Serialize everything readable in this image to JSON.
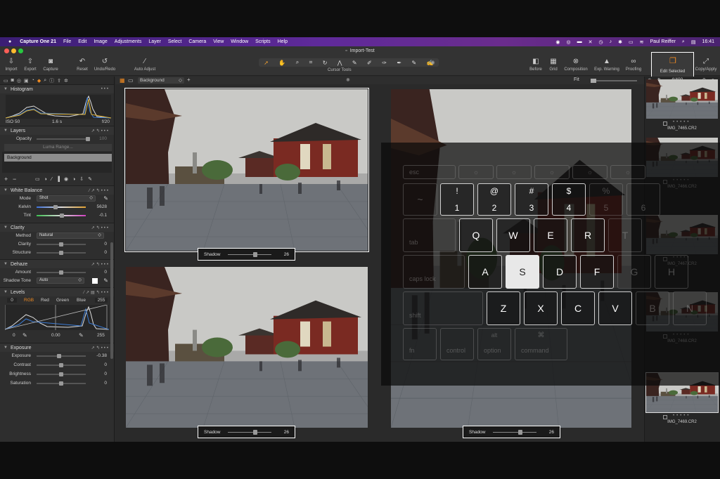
{
  "menubar": {
    "app": "Capture One 21",
    "items": [
      "File",
      "Edit",
      "Image",
      "Adjustments",
      "Layer",
      "Select",
      "Camera",
      "View",
      "Window",
      "Scripts",
      "Help"
    ],
    "user": "Paul Reiffer",
    "clock": "16:41"
  },
  "window": {
    "title": "Import-Test"
  },
  "toolbar": {
    "left": [
      "Import",
      "Export",
      "Capture",
      "Reset",
      "Undo/Redo",
      "Auto Adjust"
    ],
    "cursor_tools_label": "Cursor Tools",
    "right": [
      "Before",
      "Grid",
      "Composition",
      "Exp. Warning",
      "Proofing",
      "Edit Selected",
      "Copy/Apply"
    ]
  },
  "viewer_bar": {
    "layer_select": "Background",
    "fit": "Fit",
    "counter": "4/400"
  },
  "histogram": {
    "title": "Histogram",
    "iso": "ISO 50",
    "shutter": "1.6 s",
    "aperture": "f/20"
  },
  "layers": {
    "title": "Layers",
    "opacity": "Opacity",
    "opacity_value": "100",
    "luma": "Luma Range...",
    "background": "Background"
  },
  "white_balance": {
    "title": "White Balance",
    "mode_label": "Mode",
    "mode": "Shot",
    "kelvin_label": "Kelvin",
    "kelvin": "5628",
    "tint_label": "Tint",
    "tint": "-0.1"
  },
  "clarity": {
    "title": "Clarity",
    "method_label": "Method",
    "method": "Natural",
    "clarity_label": "Clarity",
    "clarity": "0",
    "structure_label": "Structure",
    "structure": "0"
  },
  "dehaze": {
    "title": "Dehaze",
    "amount_label": "Amount",
    "amount": "0",
    "tone_label": "Shadow Tone",
    "tone": "Auto"
  },
  "levels": {
    "title": "Levels",
    "low": "0",
    "channels": [
      "RGB",
      "Red",
      "Green",
      "Blue"
    ],
    "high": "255",
    "out_low": "0",
    "mid": "0.00",
    "out_high": "255"
  },
  "exposure": {
    "title": "Exposure",
    "rows": [
      {
        "label": "Exposure",
        "value": "-0.38",
        "pos": 0.45
      },
      {
        "label": "Contrast",
        "value": "0",
        "pos": 0.5
      },
      {
        "label": "Brightness",
        "value": "0",
        "pos": 0.5
      },
      {
        "label": "Saturation",
        "value": "0",
        "pos": 0.5
      }
    ]
  },
  "shadow_overlay": {
    "label": "Shadow",
    "value": "26"
  },
  "filmstrip": {
    "names": [
      "IMG_7465.CR2",
      "IMG_7466.CR2",
      "IMG_7467.CR2",
      "IMG_7468.CR2",
      "IMG_7469.CR2"
    ]
  },
  "keyboard": {
    "fn_row": [
      "esc"
    ],
    "num_row": [
      {
        "top": "!",
        "bot": "1"
      },
      {
        "top": "@",
        "bot": "2"
      },
      {
        "top": "#",
        "bot": "3"
      },
      {
        "top": "$",
        "bot": "4"
      },
      {
        "top": "%",
        "bot": "5"
      },
      {
        "top": "",
        "bot": "6"
      }
    ],
    "q_row": [
      "Q",
      "W",
      "E",
      "R",
      "T"
    ],
    "a_row": [
      "A",
      "S",
      "D",
      "F",
      "G",
      "H"
    ],
    "z_row": [
      "Z",
      "X",
      "C",
      "V",
      "B",
      "N"
    ],
    "mods": {
      "tab": "tab",
      "caps": "caps lock",
      "shift": "shift",
      "fn": "fn",
      "control": "control",
      "option": "option",
      "alt": "alt",
      "command": "command",
      "cmd_glyph": "⌘"
    },
    "active_key": "S"
  }
}
